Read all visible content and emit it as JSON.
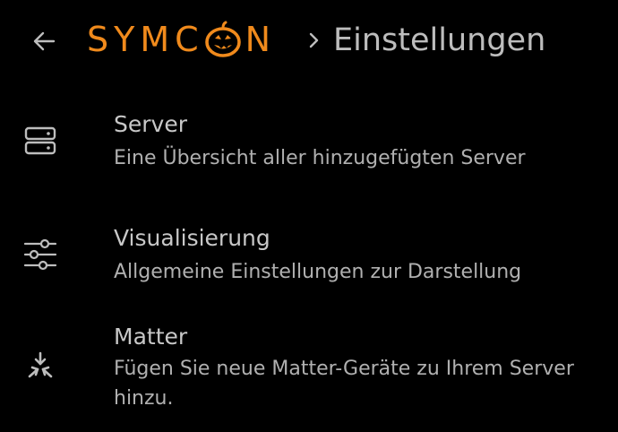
{
  "header": {
    "back_icon": "arrow-left-icon",
    "logo_text_pre": "SYMC",
    "logo_text_post": "N",
    "logo_icon": "pumpkin-icon",
    "separator_icon": "chevron-right-icon",
    "title": "Einstellungen"
  },
  "colors": {
    "accent": "#f08a1c",
    "background": "#000000",
    "text": "#bdbdbd"
  },
  "menu": {
    "items": [
      {
        "icon": "server-icon",
        "title": "Server",
        "description": "Eine Übersicht aller hinzugefügten Server"
      },
      {
        "icon": "sliders-icon",
        "title": "Visualisierung",
        "description": "Allgemeine Einstellungen zur Darstellung"
      },
      {
        "icon": "matter-icon",
        "title": "Matter",
        "description": "Fügen Sie neue Matter-Geräte zu Ihrem Server hinzu."
      }
    ]
  }
}
